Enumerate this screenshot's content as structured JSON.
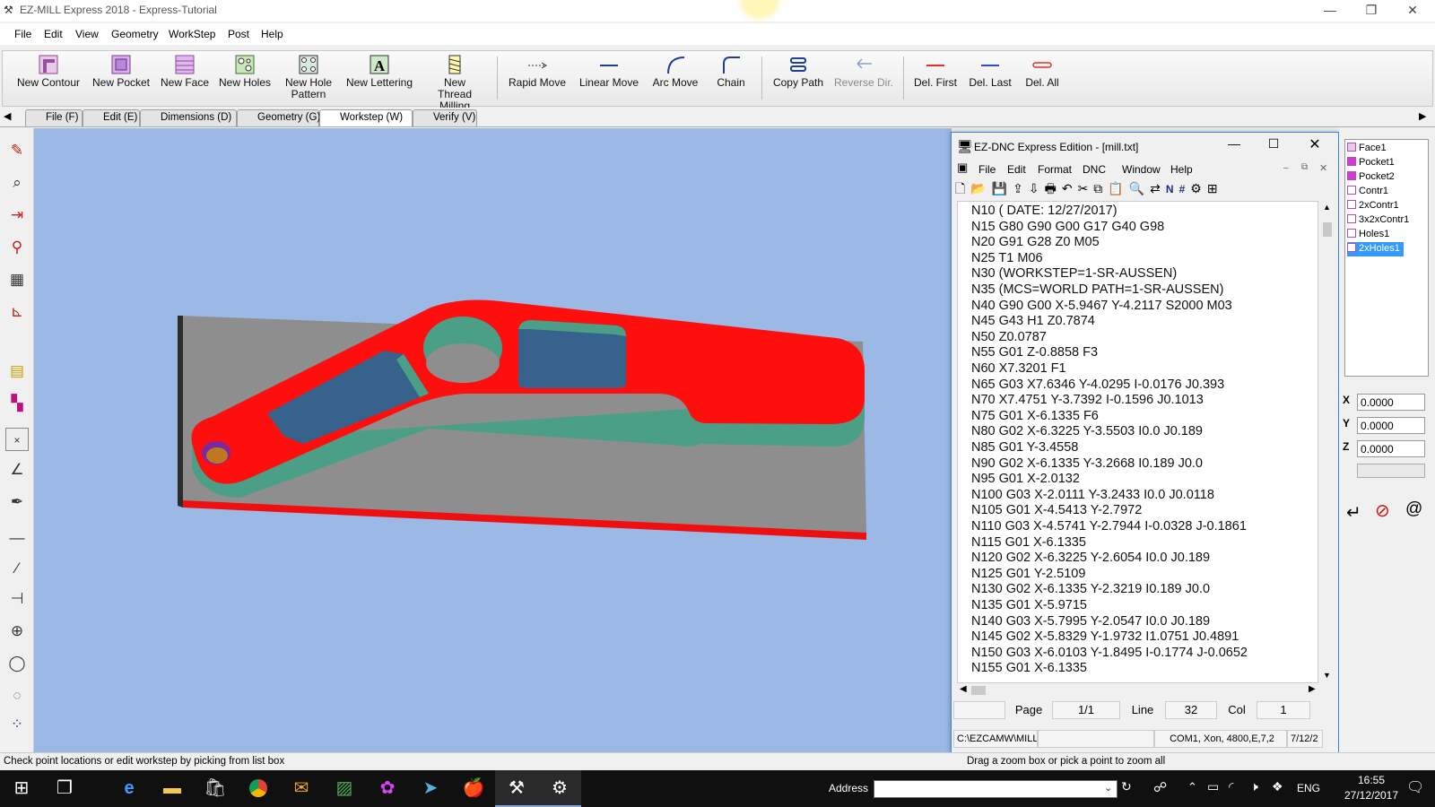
{
  "window": {
    "title": "EZ-MILL Express 2018 - Express-Tutorial",
    "minimize": "—",
    "restore": "❐",
    "close": "✕"
  },
  "menu": [
    "File",
    "Edit",
    "View",
    "Geometry",
    "WorkStep",
    "Post",
    "Help"
  ],
  "toolbar": {
    "new_contour": "New Contour",
    "new_pocket": "New Pocket",
    "new_face": "New Face",
    "new_holes": "New Holes",
    "new_hole_pattern": "New Hole Pattern",
    "new_lettering": "New Lettering",
    "new_thread_milling": "New Thread Milling",
    "rapid_move": "Rapid Move",
    "linear_move": "Linear Move",
    "arc_move": "Arc Move",
    "chain": "Chain",
    "copy_path": "Copy Path",
    "reverse_dir": "Reverse Dir.",
    "del_first": "Del. First",
    "del_last": "Del. Last",
    "del_all": "Del. All"
  },
  "tabs": [
    "File (F)",
    "Edit (E)",
    "Dimensions (D)",
    "Geometry (G)",
    "Workstep (W)",
    "Verify (V)"
  ],
  "dnc": {
    "title": "EZ-DNC  Express Edition - [mill.txt]",
    "menu": [
      "File",
      "Edit",
      "Format",
      "DNC",
      "Window",
      "Help"
    ],
    "code": [
      "N10 ( DATE: 12/27/2017)",
      "N15 G80 G90 G00 G17 G40 G98",
      "N20 G91 G28 Z0 M05",
      "N25 T1 M06",
      "N30 (WORKSTEP=1-SR-AUSSEN)",
      "N35 (MCS=WORLD PATH=1-SR-AUSSEN)",
      "N40 G90 G00 X-5.9467 Y-4.2117 S2000 M03",
      "N45 G43 H1 Z0.7874",
      "N50 Z0.0787",
      "N55 G01 Z-0.8858 F3",
      "N60 X7.3201 F1",
      "N65 G03 X7.6346 Y-4.0295 I-0.0176 J0.393",
      "N70 X7.4751 Y-3.7392 I-0.1596 J0.1013",
      "N75 G01 X-6.1335 F6",
      "N80 G02 X-6.3225 Y-3.5503 I0.0 J0.189",
      "N85 G01 Y-3.4558",
      "N90 G02 X-6.1335 Y-3.2668 I0.189 J0.0",
      "N95 G01 X-2.0132",
      "N100 G03 X-2.0111 Y-3.2433 I0.0 J0.0118",
      "N105 G01 X-4.5413 Y-2.7972",
      "N110 G03 X-4.5741 Y-2.7944 I-0.0328 J-0.1861",
      "N115 G01 X-6.1335",
      "N120 G02 X-6.3225 Y-2.6054 I0.0 J0.189",
      "N125 G01 Y-2.5109",
      "N130 G02 X-6.1335 Y-2.3219 I0.189 J0.0",
      "N135 G01 X-5.9715",
      "N140 G03 X-5.7995 Y-2.0547 I0.0 J0.189",
      "N145 G02 X-5.8329 Y-1.9732 I1.0751 J0.4891",
      "N150 G03 X-6.0103 Y-1.8495 I-0.1774 J-0.0652",
      "N155 G01 X-6.1335"
    ],
    "status": {
      "page_label": "Page",
      "page_value": "1/1",
      "line_label": "Line",
      "line_value": "32",
      "col_label": "Col",
      "col_value": "1"
    },
    "status2": {
      "path": "C:\\EZCAMW\\MILL",
      "port": "COM1, Xon, 4800,E,7,2",
      "date": "7/12/2"
    }
  },
  "tree": [
    "Face1",
    "Pocket1",
    "Pocket2",
    "Contr1",
    "2xContr1",
    "3x2xContr1",
    "Holes1",
    "2xHoles1"
  ],
  "coords": {
    "x_label": "X",
    "x": "0.0000",
    "y_label": "Y",
    "y": "0.0000",
    "z_label": "Z",
    "z": "0.0000"
  },
  "status": {
    "left": "Check point locations or edit workstep by picking from list box",
    "right": "Drag a zoom box or pick a point to zoom all"
  },
  "taskbar": {
    "address_label": "Address",
    "lang": "ENG",
    "time": "16:55",
    "date": "27/12/2017"
  }
}
